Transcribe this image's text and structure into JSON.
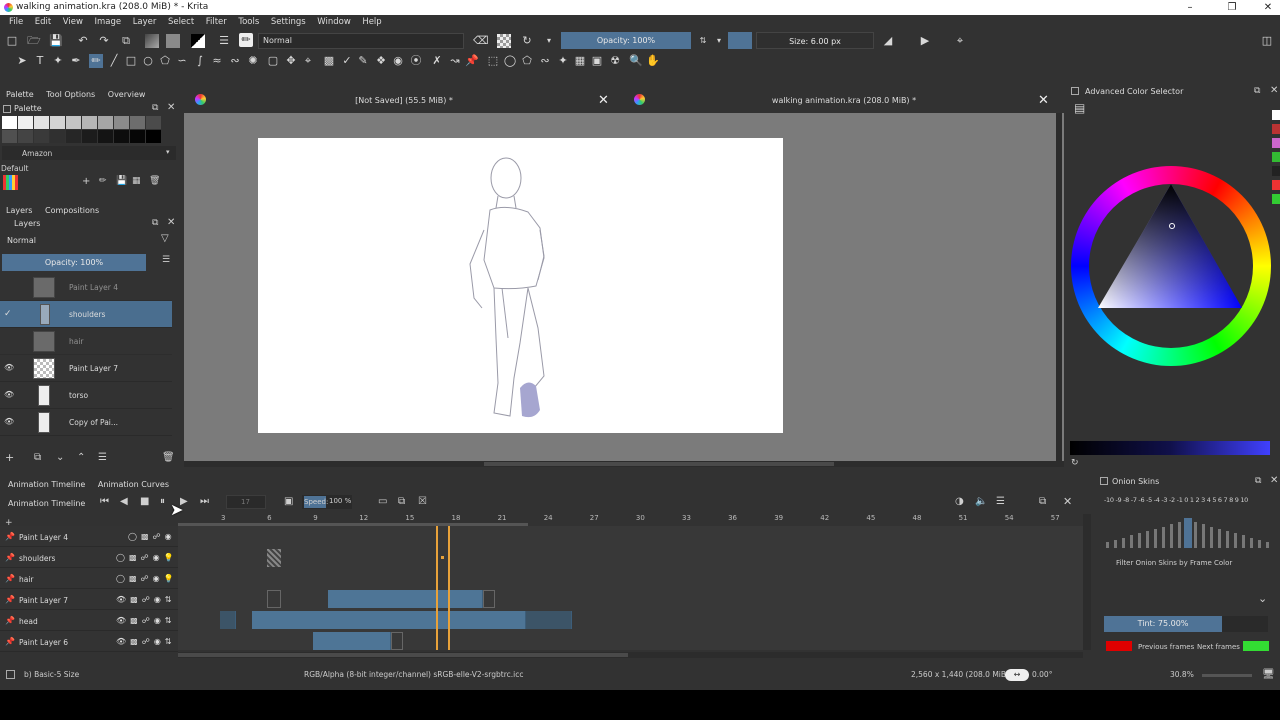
{
  "window": {
    "title": "walking animation.kra (208.0 MiB) * - Krita"
  },
  "menu": [
    "File",
    "Edit",
    "View",
    "Image",
    "Layer",
    "Select",
    "Filter",
    "Tools",
    "Settings",
    "Window",
    "Help"
  ],
  "toolbar": {
    "blend_mode": "Normal",
    "opacity_label": "Opacity: 100%",
    "size_label": "Size: 6.00 px"
  },
  "left_dock": {
    "tabs": [
      "Palette",
      "Tool Options",
      "Overview"
    ],
    "palette_title": "Palette",
    "palette_name": "Amazon",
    "default_label": "Default",
    "layers_tabs": [
      "Layers",
      "Compositions"
    ],
    "layers_title": "Layers",
    "blend_mode": "Normal",
    "opacity_label": "Opacity:  100%",
    "layers": [
      {
        "name": "Paint Layer 4",
        "visible": false,
        "selected": false
      },
      {
        "name": "shoulders",
        "visible": false,
        "selected": true
      },
      {
        "name": "hair",
        "visible": false,
        "selected": false
      },
      {
        "name": "Paint Layer 7",
        "visible": true,
        "selected": false
      },
      {
        "name": "torso",
        "visible": true,
        "selected": false
      },
      {
        "name": "Copy of Pai...",
        "visible": true,
        "selected": false
      }
    ]
  },
  "documents": [
    {
      "title": "[Not Saved]  (55.5 MiB) *"
    },
    {
      "title": "walking animation.kra (208.0 MiB) *"
    }
  ],
  "right_dock": {
    "title": "Advanced Color Selector"
  },
  "timeline": {
    "tabs": [
      "Animation Timeline",
      "Animation Curves"
    ],
    "title": "Animation Timeline",
    "frame_value": "17",
    "speed_label": "Speed:",
    "speed_value": "100 %",
    "ruler": [
      "3",
      "6",
      "9",
      "12",
      "15",
      "18",
      "21",
      "24",
      "27",
      "30",
      "33",
      "36",
      "39",
      "42",
      "45",
      "48",
      "51",
      "54",
      "57"
    ],
    "current_frame": 17,
    "layers": [
      "Paint Layer 4",
      "shoulders",
      "hair",
      "Paint Layer 7",
      "head",
      "Paint Layer 6"
    ]
  },
  "onion": {
    "title": "Onion Skins",
    "numbers": "-10 -9 -8 -7 -6 -5 -4 -3 -2 -1  0  1 2 3 4 5 6 7 8 9 10",
    "filter_label": "Filter Onion Skins by Frame Color",
    "tint_label": "Tint: 75.00%",
    "prev_label": "Previous frames",
    "next_label": "Next frames",
    "prev_color": "#e00000",
    "next_color": "#33dd33"
  },
  "status": {
    "brush": "b) Basic-5 Size",
    "color_space": "RGB/Alpha (8-bit integer/channel)  sRGB-elle-V2-srgbtrc.icc",
    "dimensions": "2,560 x 1,440 (208.0 MiB)",
    "rotation": "0.00°",
    "zoom": "30.8%"
  },
  "colors": {
    "accent": "#4f7396",
    "frame_cursor": "#e8a23a"
  }
}
